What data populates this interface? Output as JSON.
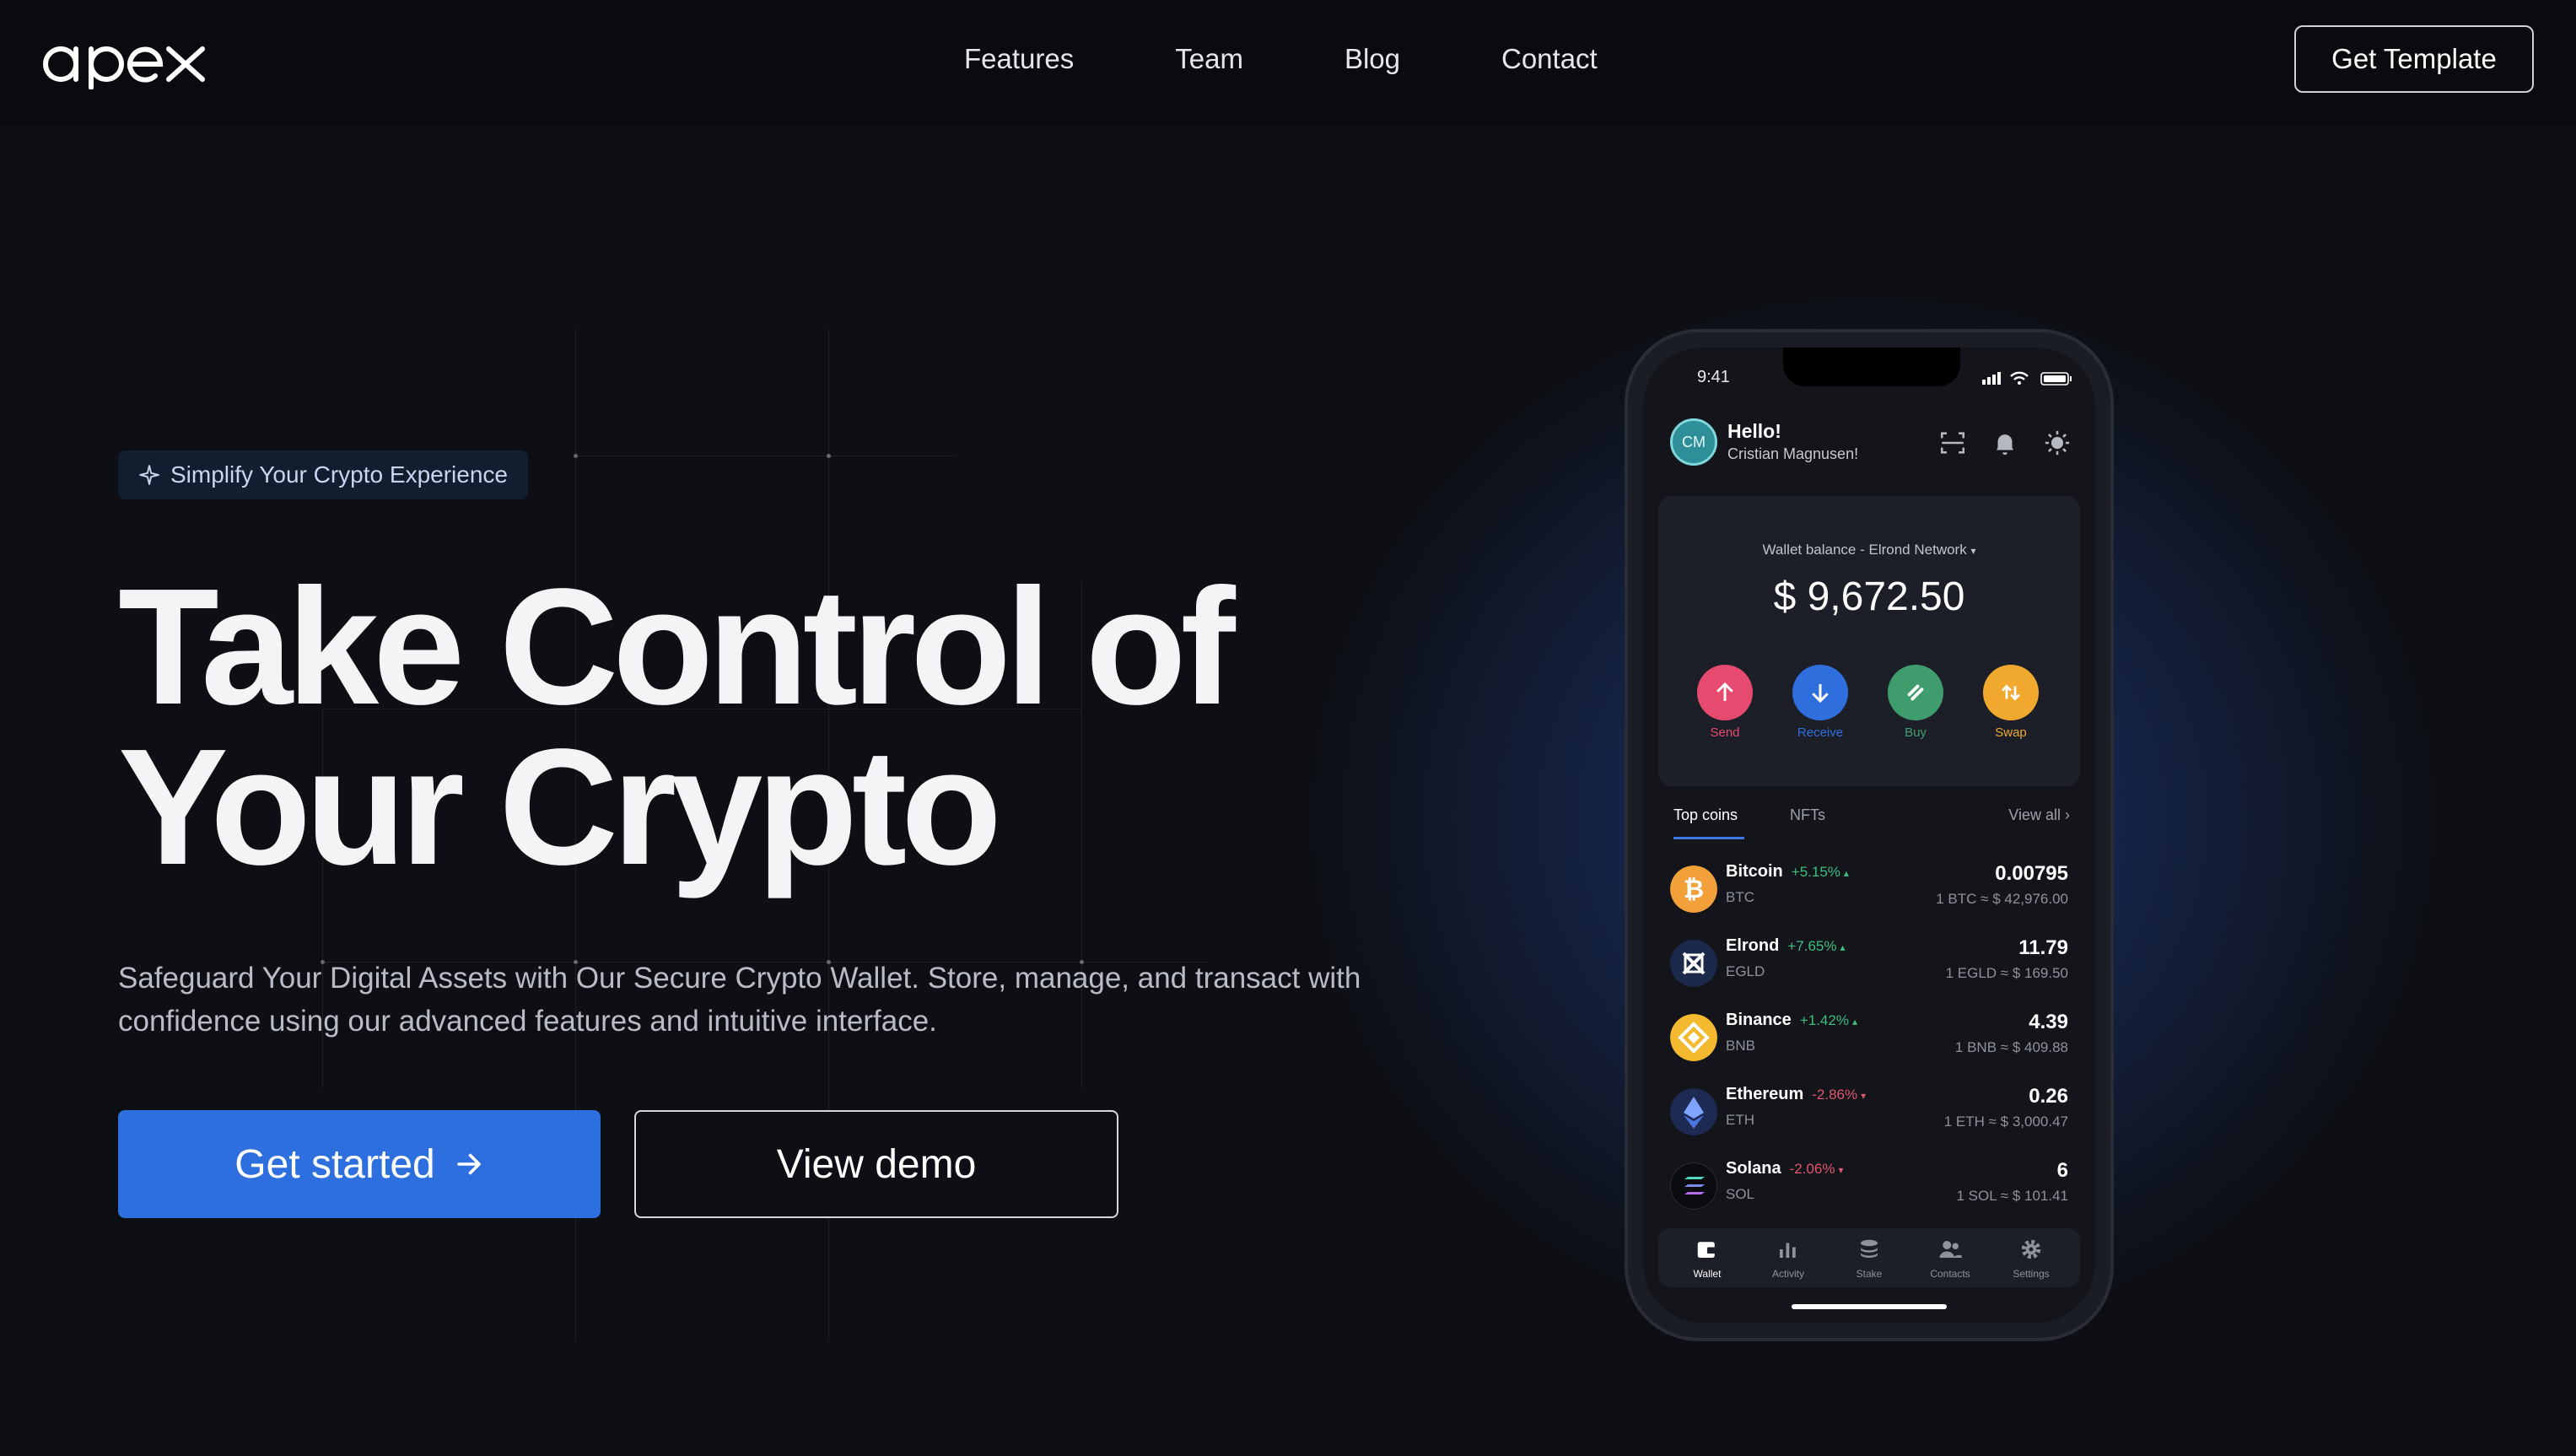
{
  "nav": {
    "links": [
      "Features",
      "Team",
      "Blog",
      "Contact"
    ],
    "cta": "Get Template"
  },
  "hero": {
    "badge": "Simplify Your Crypto Experience",
    "headline_line1": "Take Control of",
    "headline_line2": "Your Crypto",
    "subtitle": "Safeguard Your Digital Assets with Our Secure Crypto Wallet. Store, manage, and transact with confidence using our advanced features and intuitive interface.",
    "primary_button": "Get started",
    "secondary_button": "View demo"
  },
  "phone": {
    "time": "9:41",
    "greeting": "Hello!",
    "user_name": "Cristian Magnusen!",
    "avatar_initials": "CM",
    "balance_label": "Wallet balance - Elrond Network",
    "balance_value": "$ 9,672.50",
    "actions": [
      {
        "label": "Send",
        "color": "#e64a6e"
      },
      {
        "label": "Receive",
        "color": "#2f6fdd"
      },
      {
        "label": "Buy",
        "color": "#3f9c6d"
      },
      {
        "label": "Swap",
        "color": "#f0a92e"
      }
    ],
    "tabs": [
      "Top coins",
      "NFTs"
    ],
    "view_all": "View all",
    "coins": [
      {
        "name": "Bitcoin",
        "change": "+5.15%",
        "symbol": "BTC",
        "amount": "0.00795",
        "conversion": "1 BTC ≈ $ 42,976.00",
        "icon_color": "#f2a03a"
      },
      {
        "name": "Elrond",
        "change": "+7.65%",
        "symbol": "EGLD",
        "amount": "11.79",
        "conversion": "1 EGLD ≈ $ 169.50",
        "icon_color": "#1b2a4a"
      },
      {
        "name": "Binance",
        "change": "+1.42%",
        "symbol": "BNB",
        "amount": "4.39",
        "conversion": "1 BNB ≈ $ 409.88",
        "icon_color": "#f3ba2f"
      },
      {
        "name": "Ethereum",
        "change": "-2.86%",
        "symbol": "ETH",
        "amount": "0.26",
        "conversion": "1 ETH ≈ $ 3,000.47",
        "icon_color": "#1d2b52"
      },
      {
        "name": "Solana",
        "change": "-2.06%",
        "symbol": "SOL",
        "amount": "6",
        "conversion": "1 SOL ≈ $ 101.41",
        "icon_color": "#0b0c10"
      }
    ],
    "positive_color": "#3fbf7f",
    "negative_color": "#e2566e",
    "bottom_nav": [
      "Wallet",
      "Activity",
      "Stake",
      "Contacts",
      "Settings"
    ]
  },
  "colors": {
    "background": "#0d0f14",
    "accent": "#2e6fe0"
  }
}
